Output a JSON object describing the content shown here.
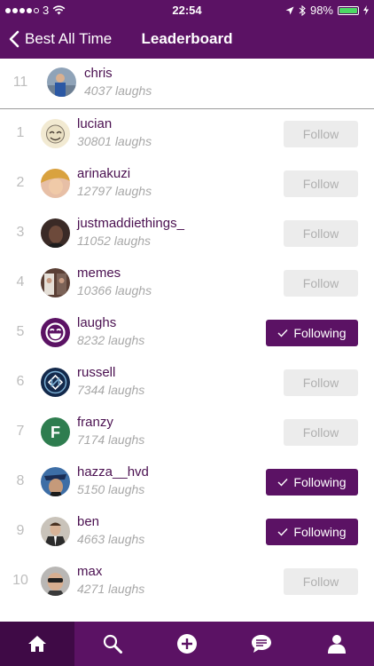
{
  "status_bar": {
    "carrier": "3",
    "time": "22:54",
    "battery": "98%",
    "battery_level": 0.98
  },
  "nav": {
    "back_label": "Best All Time",
    "title": "Leaderboard"
  },
  "current_user": {
    "rank": "11",
    "name": "chris",
    "laughs": "4037 laughs"
  },
  "leaderboard": [
    {
      "rank": "1",
      "name": "lucian",
      "laughs": "30801 laughs",
      "button": "Follow"
    },
    {
      "rank": "2",
      "name": "arinakuzi",
      "laughs": "12797 laughs",
      "button": "Follow"
    },
    {
      "rank": "3",
      "name": "justmaddiethings_",
      "laughs": "11052 laughs",
      "button": "Follow"
    },
    {
      "rank": "4",
      "name": "memes",
      "laughs": "10366 laughs",
      "button": "Follow"
    },
    {
      "rank": "5",
      "name": "laughs",
      "laughs": "8232 laughs",
      "button": "Following"
    },
    {
      "rank": "6",
      "name": "russell",
      "laughs": "7344 laughs",
      "button": "Follow"
    },
    {
      "rank": "7",
      "name": "franzy",
      "laughs": "7174 laughs",
      "button": "Follow",
      "avatar_letter": "F"
    },
    {
      "rank": "8",
      "name": "hazza__hvd",
      "laughs": "5150 laughs",
      "button": "Following"
    },
    {
      "rank": "9",
      "name": "ben",
      "laughs": "4663 laughs",
      "button": "Following"
    },
    {
      "rank": "10",
      "name": "max",
      "laughs": "4271 laughs",
      "button": "Follow"
    }
  ],
  "tabs": [
    {
      "icon": "home-icon",
      "active": true
    },
    {
      "icon": "search-icon",
      "active": false
    },
    {
      "icon": "add-icon",
      "active": false
    },
    {
      "icon": "chat-icon",
      "active": false
    },
    {
      "icon": "profile-icon",
      "active": false
    }
  ],
  "colors": {
    "brand": "#5b1264",
    "brand_dark": "#3f0a46",
    "follow_bg": "#ececec",
    "follow_text": "#b0b0b0"
  }
}
